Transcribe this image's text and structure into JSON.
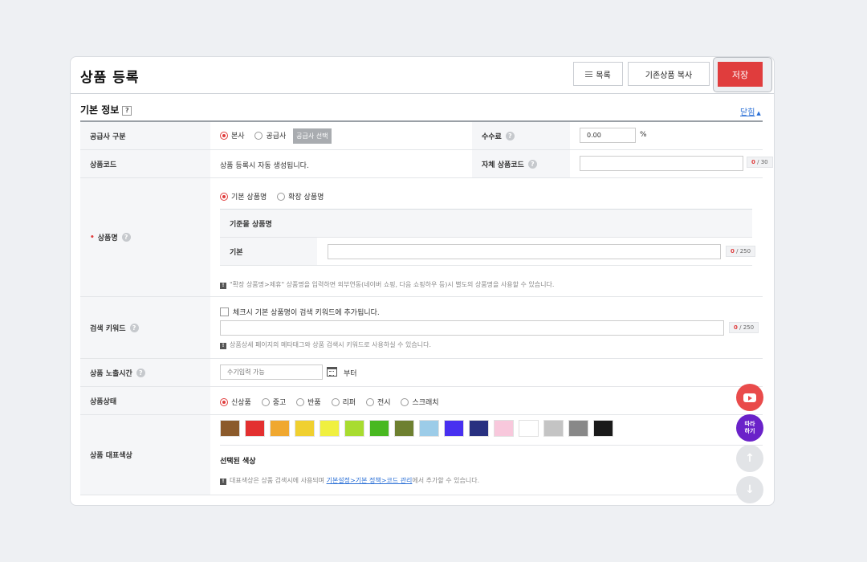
{
  "header": {
    "title": "상품 등록",
    "list_label": "목록",
    "copy_label": "기존상품 복사",
    "save_label": "저장"
  },
  "section": {
    "title": "기본 정보",
    "help": "?",
    "collapse_label": "닫힘"
  },
  "supplier": {
    "label": "공급사 구분",
    "options": [
      "본사",
      "공급사"
    ],
    "selected": "본사",
    "select_button": "공급사 선택",
    "fee_label": "수수료",
    "fee_value": "0.00",
    "fee_unit": "%"
  },
  "product_code": {
    "label": "상품코드",
    "value": "상품 등록시 자동 생성됩니다.",
    "own_code_label": "자체 상품코드",
    "own_code_count": "0",
    "own_code_max": "/ 30"
  },
  "product_name": {
    "label": "상품명",
    "options": [
      "기본 상품명",
      "확장 상품명"
    ],
    "selected": "기본 상품명",
    "sub_header": "기준몰 상품명",
    "sub_row_label": "기본",
    "count": "0",
    "max": "/ 250",
    "note_icon": "!",
    "note": "\"확장 상품명>제휴\" 상품명을 입력하면 외부연동(네이버 쇼핑, 다음 쇼핑하우 등)시 별도의 상품명을 사용할 수 있습니다."
  },
  "keyword": {
    "label": "검색 키워드",
    "checkbox_label": "체크시 기본 상품명이 검색 키워드에 추가됩니다.",
    "count": "0",
    "max": "/ 250",
    "note": "상품상세 페이지의 메타태그와 상품 검색시 키워드로 사용하실 수 있습니다."
  },
  "exposure": {
    "label": "상품 노출시간",
    "placeholder": "수기입력 가능",
    "suffix": "부터"
  },
  "status": {
    "label": "상품상태",
    "options": [
      "신상품",
      "중고",
      "반품",
      "리퍼",
      "전시",
      "스크래치"
    ],
    "selected": "신상품"
  },
  "color": {
    "label": "상품 대표색상",
    "swatches": [
      "#8b5a2b",
      "#e33030",
      "#f0a830",
      "#f0d030",
      "#f0f040",
      "#a8dc30",
      "#48b820",
      "#6e8030",
      "#9ccce8",
      "#4830f0",
      "#283080",
      "#f8c8dc",
      "#ffffff",
      "#c4c4c4",
      "#888888",
      "#1a1a1a"
    ],
    "selected_label": "선택된 색상",
    "note_before": "대표색상은 상품 검색시에 사용되며 ",
    "note_link": "기본설정>기본 정책>코드 관리",
    "note_after": "에서 추가할 수 있습니다."
  },
  "fabs": {
    "youtube_icon": "youtube-icon",
    "follow_label_1": "따라",
    "follow_label_2": "하기",
    "up_icon": "arrow-up-icon",
    "down_icon": "arrow-down-icon"
  }
}
